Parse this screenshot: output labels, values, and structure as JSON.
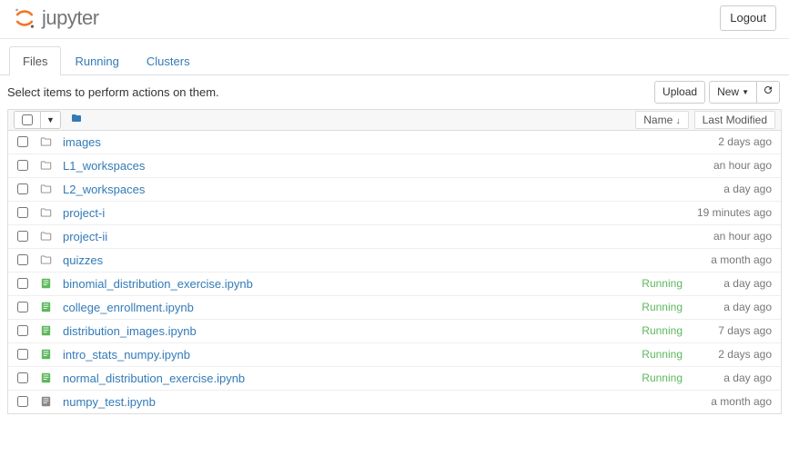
{
  "header": {
    "logo_text": "jupyter",
    "logout": "Logout"
  },
  "tabs": [
    {
      "label": "Files",
      "active": true
    },
    {
      "label": "Running",
      "active": false
    },
    {
      "label": "Clusters",
      "active": false
    }
  ],
  "toolbar": {
    "hint": "Select items to perform actions on them.",
    "upload": "Upload",
    "new": "New",
    "sort_name": "Name",
    "sort_modified": "Last Modified"
  },
  "items": [
    {
      "type": "folder",
      "name": "images",
      "status": "",
      "modified": "2 days ago"
    },
    {
      "type": "folder",
      "name": "L1_workspaces",
      "status": "",
      "modified": "an hour ago"
    },
    {
      "type": "folder",
      "name": "L2_workspaces",
      "status": "",
      "modified": "a day ago"
    },
    {
      "type": "folder",
      "name": "project-i",
      "status": "",
      "modified": "19 minutes ago"
    },
    {
      "type": "folder",
      "name": "project-ii",
      "status": "",
      "modified": "an hour ago"
    },
    {
      "type": "folder",
      "name": "quizzes",
      "status": "",
      "modified": "a month ago"
    },
    {
      "type": "notebook-running",
      "name": "binomial_distribution_exercise.ipynb",
      "status": "Running",
      "modified": "a day ago"
    },
    {
      "type": "notebook-running",
      "name": "college_enrollment.ipynb",
      "status": "Running",
      "modified": "a day ago"
    },
    {
      "type": "notebook-running",
      "name": "distribution_images.ipynb",
      "status": "Running",
      "modified": "7 days ago"
    },
    {
      "type": "notebook-running",
      "name": "intro_stats_numpy.ipynb",
      "status": "Running",
      "modified": "2 days ago"
    },
    {
      "type": "notebook-running",
      "name": "normal_distribution_exercise.ipynb",
      "status": "Running",
      "modified": "a day ago"
    },
    {
      "type": "notebook",
      "name": "numpy_test.ipynb",
      "status": "",
      "modified": "a month ago"
    }
  ]
}
